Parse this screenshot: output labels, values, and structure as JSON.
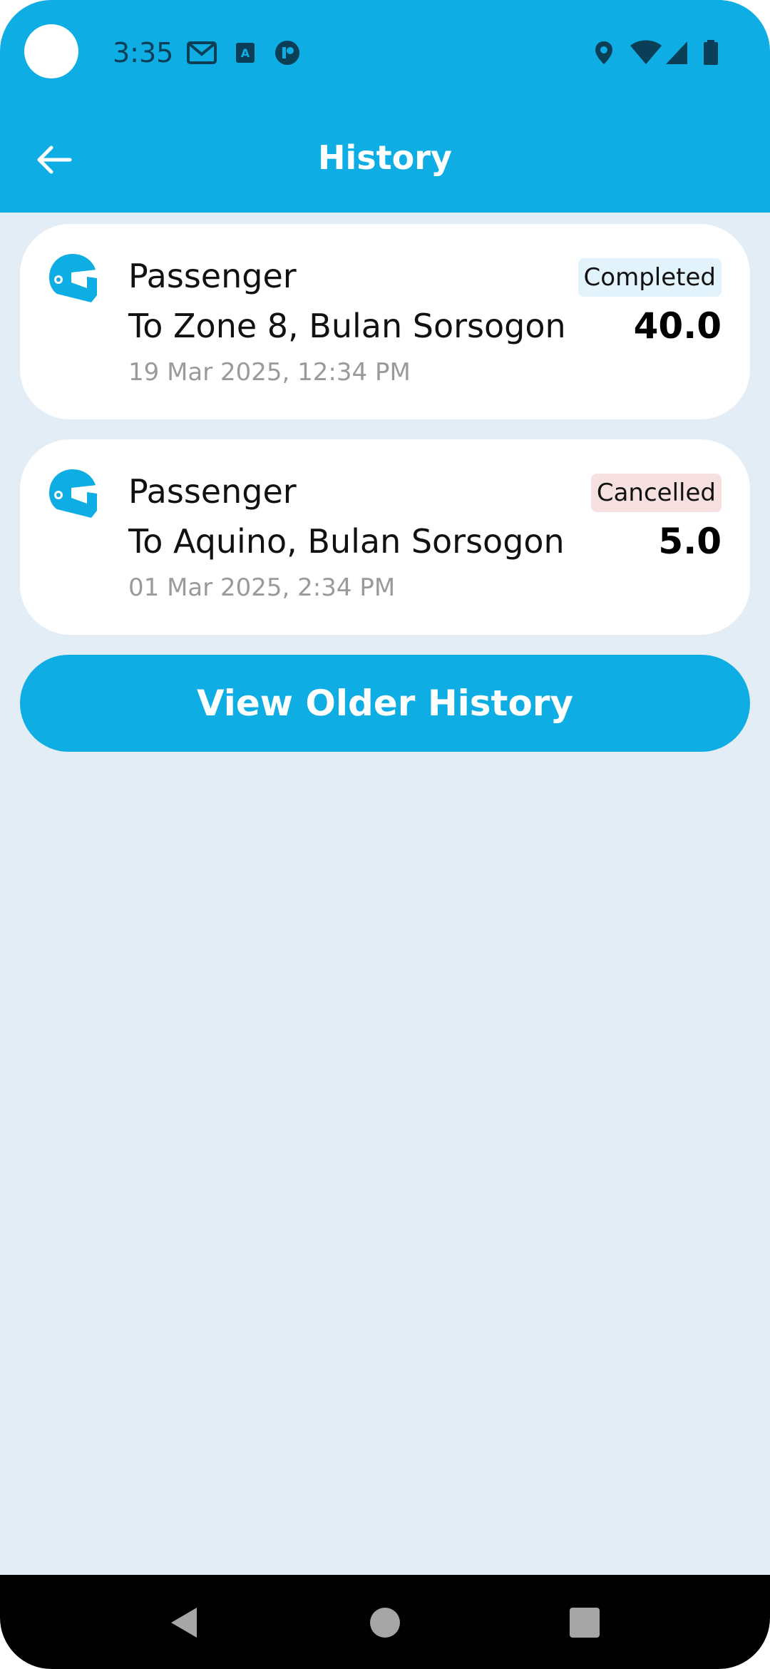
{
  "status_bar": {
    "time": "3:35",
    "left_icons": [
      "gmail-icon",
      "accessibility-app-icon",
      "app-notification-icon"
    ],
    "right_icons": [
      "location-icon",
      "wifi-icon",
      "cellular-signal-icon",
      "battery-icon"
    ]
  },
  "header": {
    "title": "History",
    "back_icon": "arrow-left-icon"
  },
  "history": [
    {
      "type": "Passenger",
      "destination": "To Zone 8, Bulan Sorsogon",
      "date": "19 Mar 2025, 12:34 PM",
      "status": "Completed",
      "amount": "40.0",
      "icon": "helmet-icon"
    },
    {
      "type": "Passenger",
      "destination": "To Aquino, Bulan Sorsogon",
      "date": "01 Mar 2025, 2:34 PM",
      "status": "Cancelled",
      "amount": "5.0",
      "icon": "helmet-icon"
    }
  ],
  "older_button": {
    "label": "View Older History"
  },
  "nav": {
    "icons": [
      "back-triangle-icon",
      "home-circle-icon",
      "recents-square-icon"
    ]
  },
  "colors": {
    "primary": "#0EADE4",
    "background": "#E3EDF6",
    "completed_badge": "#E2F3FC",
    "cancelled_badge": "#F7E0E0"
  }
}
